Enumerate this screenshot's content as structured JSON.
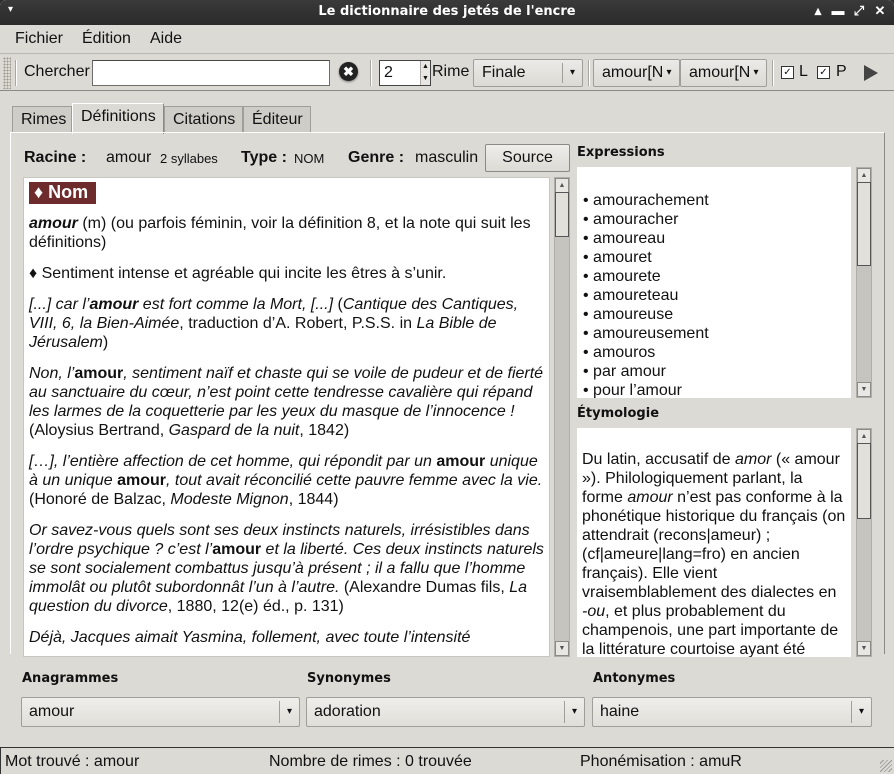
{
  "window": {
    "title": "Le dictionnaire des jetés de l'encre",
    "controls": {
      "menu": "▾",
      "shade": "▴",
      "minimize": "▬",
      "maximize": "⤢",
      "close": "✕"
    }
  },
  "menubar": {
    "items": [
      "Fichier",
      "Édition",
      "Aide"
    ]
  },
  "toolbar": {
    "search_label": "Chercher",
    "search_value": "",
    "clear_icon": "✖",
    "spin_value": "2",
    "rime_label": "Rime",
    "rime_select": "Finale",
    "word_select_1": "amour[N",
    "word_select_2": "amour[N",
    "check_l": {
      "label": "L",
      "checked": true
    },
    "check_p": {
      "label": "P",
      "checked": true
    },
    "check_mark": "✓"
  },
  "tabs": [
    "Rimes",
    "Définitions",
    "Citations",
    "Éditeur"
  ],
  "active_tab": "Définitions",
  "meta": {
    "racine_label": "Racine :",
    "racine_value": "amour",
    "syllabes": "2 syllabes",
    "type_label": "Type :",
    "type_value": "NOM",
    "genre_label": "Genre :",
    "genre_value": "masculin",
    "source_button": "Source"
  },
  "definition": {
    "badge": "♦ Nom",
    "headword": "amour",
    "intro": " (m) (ou parfois féminin, voir la définition 8, et la note qui suit les définitions)",
    "sense1": "♦ Sentiment intense et agréable qui incite les êtres à s’unir.",
    "q1": {
      "a": "[...] car l’",
      "b": "amour",
      "c": " est fort comme la Mort, [...]",
      "d": " (",
      "e": "Cantique des Cantiques, VIII, 6, la Bien-Aimée",
      "f": ", traduction d’A. Robert, P.S.S. in ",
      "g": "La Bible de Jérusalem",
      "h": ")"
    },
    "q2": {
      "a": "Non, l’",
      "b": "amour",
      "c": ", sentiment naïf et chaste qui se voile de pudeur et de fierté au sanctuaire du cœur, n’est point cette tendresse cavalière qui répand les larmes de la coquetterie par les yeux du masque de l’innocence !",
      "d": " (Aloysius Bertrand, ",
      "e": "Gaspard de la nuit",
      "f": ", 1842)"
    },
    "q3": {
      "a": "[…], l’entière affection de cet homme, qui répondit par un ",
      "b": "amour",
      "c": " unique à un unique ",
      "d": "amour",
      "e": ", tout avait réconcilié cette pauvre femme avec la vie.",
      "f": " (Honoré de Balzac, ",
      "g": "Modeste Mignon",
      "h": ", 1844)"
    },
    "q4": {
      "a": "Or savez-vous quels sont ses deux instincts naturels, irrésistibles dans l’ordre psychique ? c’est l’",
      "b": "amour",
      "c": " et la liberté. Ces deux instincts naturels se sont socialement combattus jusqu’à présent ; il a fallu que l’homme immolât ou plutôt subordonnât l’un à l’autre.",
      "d": " (Alexandre Dumas fils, ",
      "e": "La question du divorce",
      "f": ", 1880, 12(e) éd., p. 131)"
    },
    "q5": {
      "a": "Déjà, Jacques aimait Yasmina, follement, avec toute l’intensité"
    }
  },
  "expressions": {
    "title": "Expressions",
    "items": [
      "• amourachement",
      "• amouracher",
      "• amoureau",
      "• amouret",
      "• amourete",
      "• amoureteau",
      "• amoureuse",
      "• amoureusement",
      "• amouros",
      "• par amour",
      "• pour l’amour"
    ]
  },
  "etymologie": {
    "title": "Étymologie",
    "p1": "Du latin, accusatif de ",
    "p1i": "amor",
    "p2": " (« amour »). Philologiquement parlant, la forme ",
    "p2i": "amour",
    "p3": " n’est pas conforme à la phonétique historique du français (on attendrait (recons|ameur) ; (cf|ameure|lang=fro) en ancien français). Elle vient vraisemblablement des dialectes en ",
    "p3i": "-ou",
    "p4": ", et plus probablement du champenois, une part importante de la littérature courtoise ayant été"
  },
  "anagrammes": {
    "title": "Anagrammes",
    "value": "amour"
  },
  "synonymes": {
    "title": "Synonymes",
    "value": "adoration"
  },
  "antonymes": {
    "title": "Antonymes",
    "value": "haine"
  },
  "dropdown_icon": "▾",
  "status": {
    "mot_trouve": "Mot trouvé :  amour",
    "rimes": "Nombre de rimes :  0 trouvée",
    "phonemisation": "Phonémisation :  amuR"
  }
}
